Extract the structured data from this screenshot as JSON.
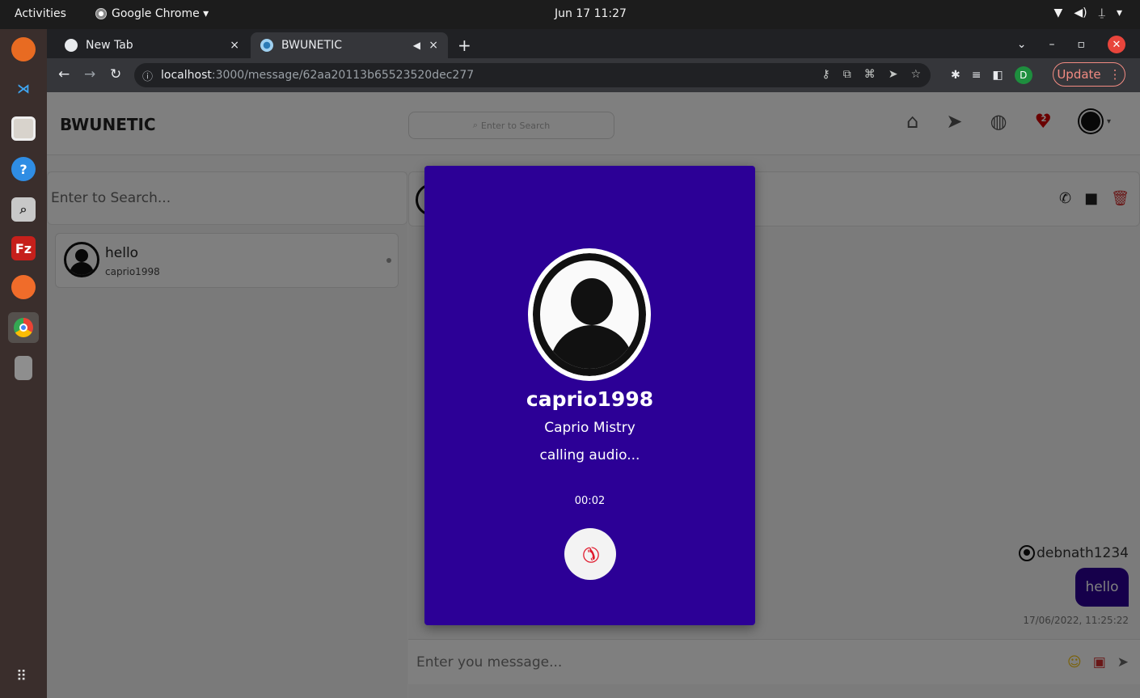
{
  "os": {
    "activities": "Activities",
    "app_menu": "Google Chrome ▾",
    "clock": "Jun 17  11:27",
    "sys_icons": [
      "▼",
      "◀)",
      "⍊",
      "▾"
    ]
  },
  "dock": {
    "apps": [
      "firefox-icon",
      "vscode-icon",
      "files-icon",
      "help-icon",
      "screenshot-icon",
      "filezilla-icon",
      "postman-icon",
      "chrome-icon",
      "usb-drive-icon",
      "show-apps-icon"
    ]
  },
  "browser": {
    "tabs": [
      {
        "label": "New Tab",
        "close": "×"
      },
      {
        "label": "BWUNETIC",
        "close": "×",
        "audio": "◀"
      }
    ],
    "new_tab": "+",
    "url_host": "localhost",
    "url_path": ":3000/message/62aa20113b65523520dec277",
    "update_label": "Update",
    "profile_initial": "D"
  },
  "app": {
    "brand": "BWUNETIC",
    "header_search_placeholder": "Enter to Search",
    "notification_count": "2"
  },
  "sidebar": {
    "search_placeholder": "Enter to Search...",
    "chats": [
      {
        "name": "hello",
        "username": "caprio1998"
      }
    ]
  },
  "chat": {
    "messages": [
      {
        "sender": "debnath1234",
        "text": "hello",
        "time": "17/06/2022, 11:25:22"
      }
    ],
    "composer_placeholder": "Enter you message..."
  },
  "call": {
    "username": "caprio1998",
    "fullname": "Caprio Mistry",
    "status": "calling audio...",
    "timer": "00:02"
  },
  "colors": {
    "call_bg": "#2c0096",
    "hangup_icon": "#e0192c",
    "heart": "#d50000"
  }
}
